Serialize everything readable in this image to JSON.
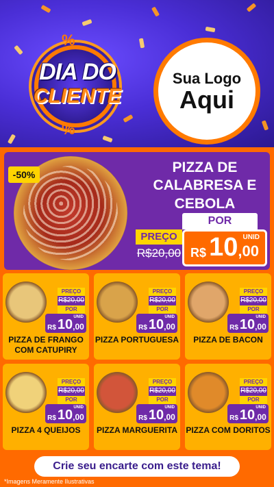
{
  "header": {
    "badge_line1": "DIA DO",
    "badge_line2": "CLIENTE",
    "percent": "%",
    "logo_line1": "Sua Logo",
    "logo_line2": "Aqui"
  },
  "featured": {
    "discount": "-50%",
    "name": "PIZZA DE CALABRESA E CEBOLA",
    "por": "POR",
    "preco": "PREÇO",
    "old_price": "R$20,00",
    "currency": "R$",
    "price_int": "10",
    "price_dec": ",00",
    "unid": "UNID"
  },
  "products": [
    {
      "name": "PIZZA DE FRANGO COM CATUPIRY",
      "preco": "PREÇO",
      "old_price": "R$20,00",
      "por": "POR",
      "currency": "R$",
      "price_int": "10",
      "price_dec": ",00",
      "unid": "UNID",
      "color": "#e8c67a"
    },
    {
      "name": "PIZZA PORTUGUESA",
      "preco": "PREÇO",
      "old_price": "R$20,00",
      "por": "POR",
      "currency": "R$",
      "price_int": "10",
      "price_dec": ",00",
      "unid": "UNID",
      "color": "#d9a34a"
    },
    {
      "name": "PIZZA DE BACON",
      "preco": "PREÇO",
      "old_price": "R$20,00",
      "por": "POR",
      "currency": "R$",
      "price_int": "10",
      "price_dec": ",00",
      "unid": "UNID",
      "color": "#e0a66a"
    },
    {
      "name": "PIZZA 4 QUEIJOS",
      "preco": "PREÇO",
      "old_price": "R$20,00",
      "por": "POR",
      "currency": "R$",
      "price_int": "10",
      "price_dec": ",00",
      "unid": "UNID",
      "color": "#f0d27a"
    },
    {
      "name": "PIZZA MARGUERITA",
      "preco": "PREÇO",
      "old_price": "R$20,00",
      "por": "POR",
      "currency": "R$",
      "price_int": "10",
      "price_dec": ",00",
      "unid": "UNID",
      "color": "#d2553a"
    },
    {
      "name": "PIZZA COM DORITOS",
      "preco": "PREÇO",
      "old_price": "R$20,00",
      "por": "POR",
      "currency": "R$",
      "price_int": "10",
      "price_dec": ",00",
      "unid": "UNID",
      "color": "#e08a2a"
    }
  ],
  "footer": {
    "cta": "Crie seu encarte com este tema!",
    "disclaimer": "*Imagens Meramente Ilustrativas"
  },
  "colors": {
    "accent": "#ff6a00",
    "purple": "#6f2aa8",
    "yellow": "#ffd400",
    "card": "#ffb000"
  }
}
